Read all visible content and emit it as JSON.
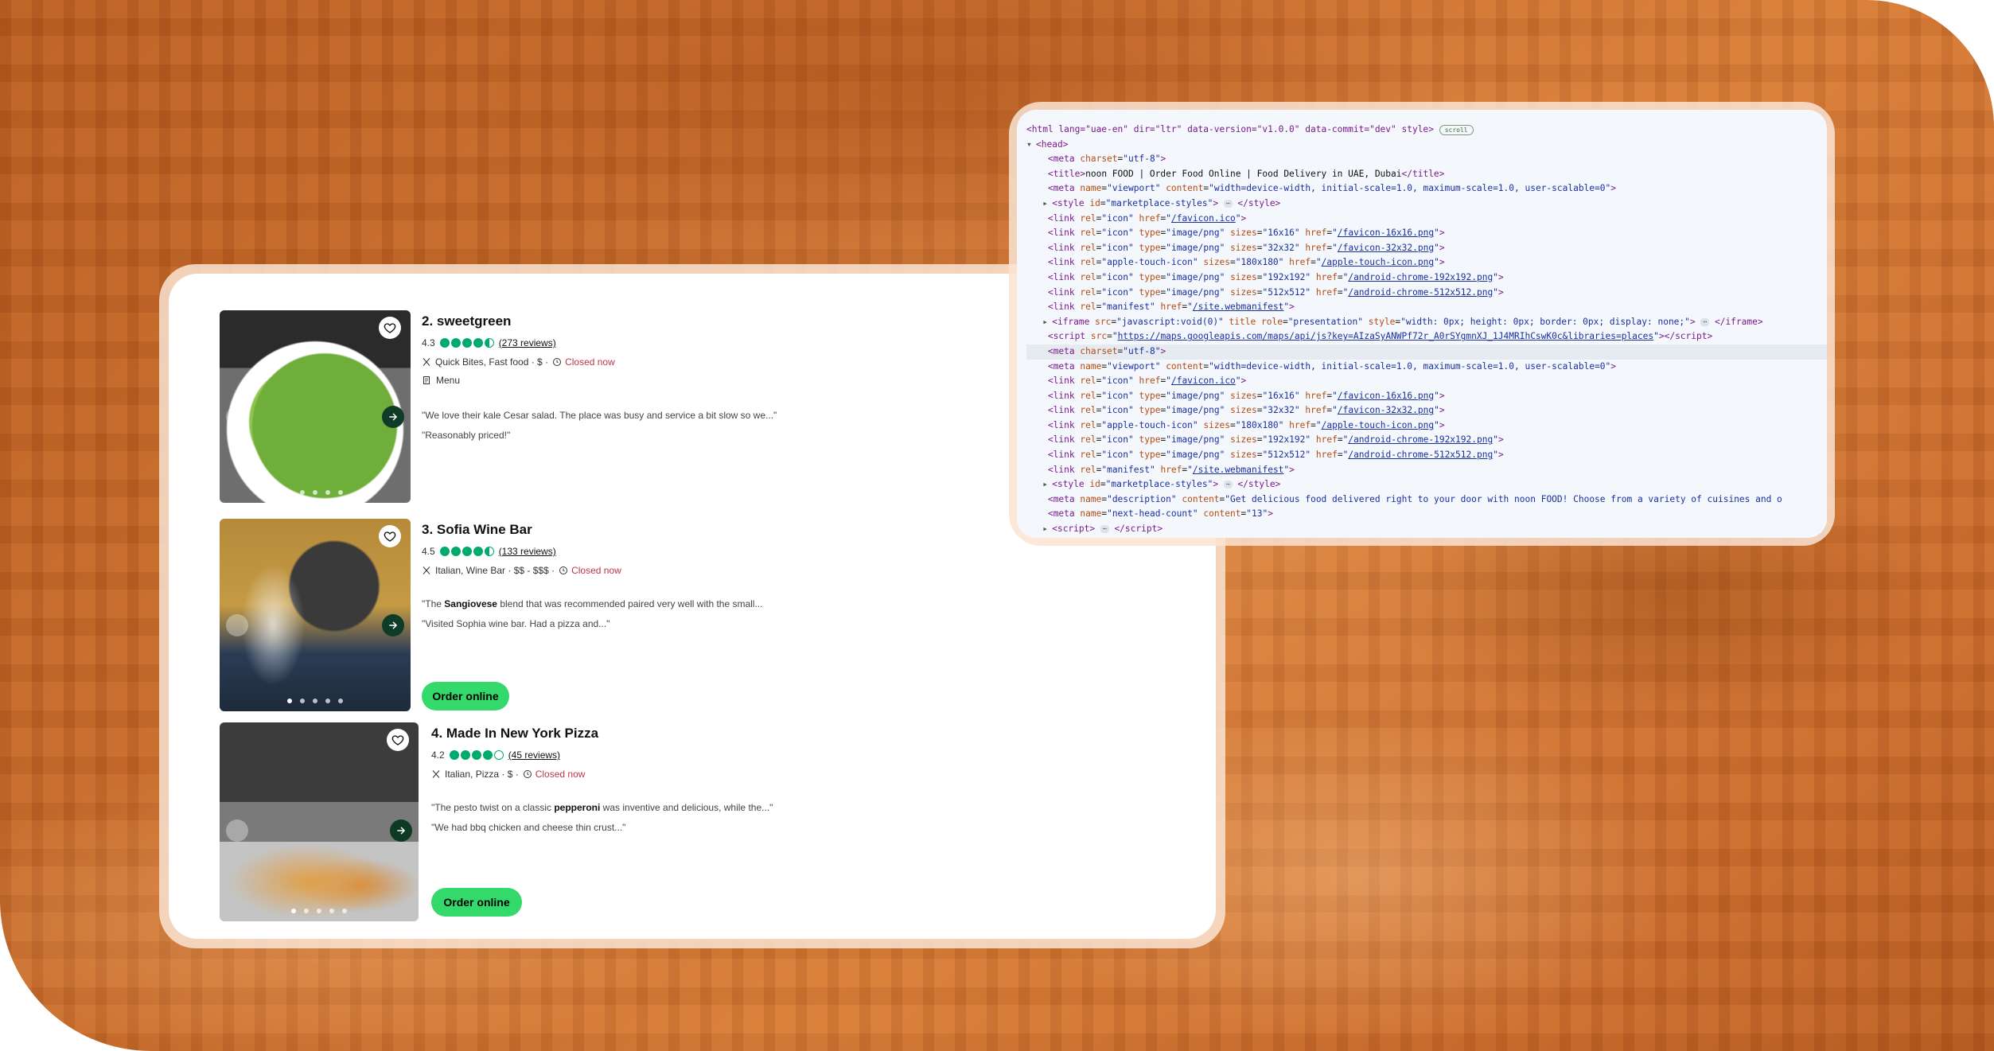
{
  "restaurants": [
    {
      "title": "2. sweetgreen",
      "rating": "4.3",
      "reviews": "(273 reviews)",
      "meta": "Quick Bites, Fast food · $ ·",
      "status": "Closed now",
      "menu_label": "Menu",
      "quotes": [
        "\"We love their kale Cesar salad. The place was busy and service a bit slow so we...\"",
        "\"Reasonably priced!\""
      ],
      "bubbles_filled": 4.5,
      "image_count": 5
    },
    {
      "title": "3. Sofia Wine Bar",
      "rating": "4.5",
      "reviews": "(133 reviews)",
      "meta": "Italian, Wine Bar · $$ - $$$ ·",
      "status": "Closed now",
      "quote_1_pre": "\"The ",
      "quote_1_bold": "Sangiovese",
      "quote_1_post": " blend that was recommended paired very well with the small...",
      "quote_2": "\"Visited Sophia wine bar. Had a pizza and...\"",
      "order_label": "Order online",
      "bubbles_filled": 4.5,
      "image_count": 5
    },
    {
      "title": "4. Made In New York Pizza",
      "rating": "4.2",
      "reviews": "(45 reviews)",
      "meta": "Italian, Pizza · $ ·",
      "status": "Closed now",
      "quote_1_pre": "\"The pesto twist on a classic ",
      "quote_1_bold": "pepperoni",
      "quote_1_post": " was inventive and delicious, while the...\"",
      "quote_2": "\"We had bbq chicken and cheese thin crust...\"",
      "order_label": "Order online",
      "bubbles_filled": 4,
      "image_count": 5
    }
  ],
  "code": {
    "html_open": "html lang=\"uae-en\" dir=\"ltr\" data-version=\"v1.0.0\" data-commit=\"dev\" style",
    "scroll_badge": "scroll",
    "head_tag": "head",
    "title_text": "noon FOOD | Order Food Online | Food Delivery in UAE, Dubai",
    "meta_description": "Get delicious food delivered right to your door with noon FOOD! Choose from a variety of cuisines and o",
    "maps_src": "https://maps.googleapis.com/maps/api/js?key=AIzaSyANWPf72r_A0rSYgmnXJ_1J4MRIhCswK0c&libraries=places",
    "next_head_count": "13",
    "ellipsis": "⋯"
  },
  "colors": {
    "accent_green": "#33d96a",
    "bubble_green": "#00aa6c",
    "closed_red": "#c0354a",
    "arrow_dark": "#0f3c26"
  }
}
